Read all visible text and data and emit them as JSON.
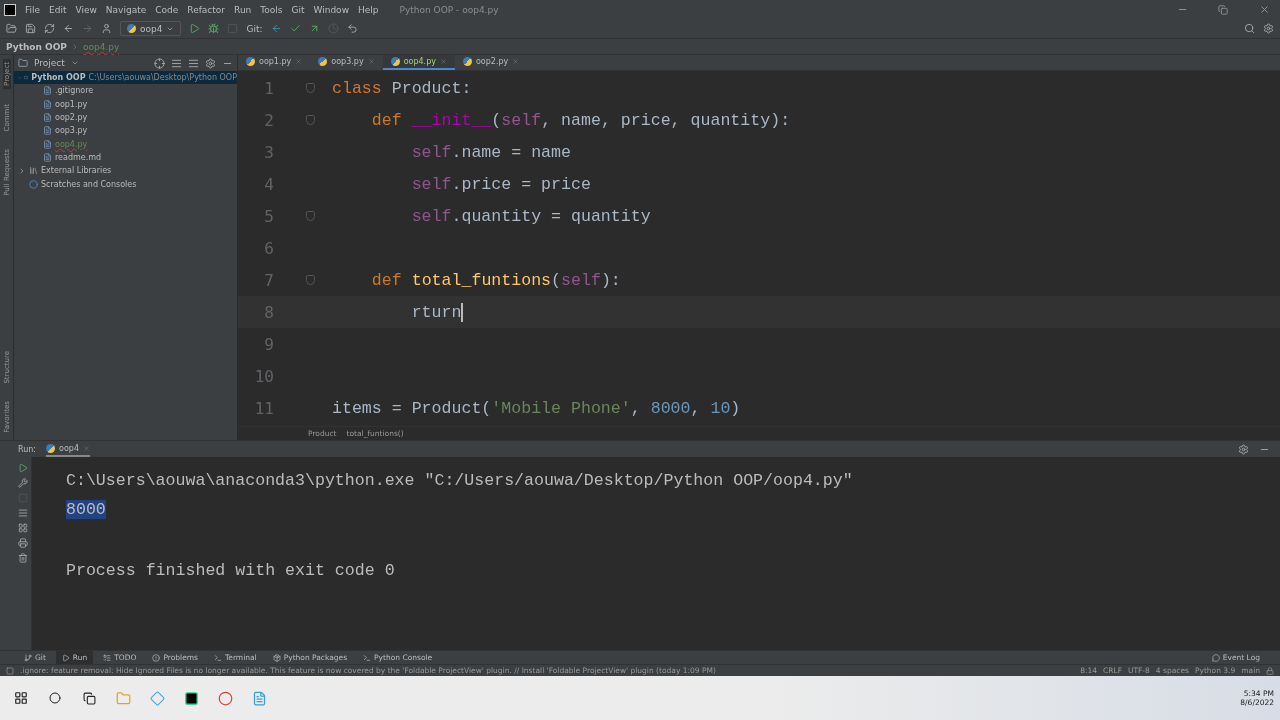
{
  "title_bar": {
    "menu": [
      "File",
      "Edit",
      "View",
      "Navigate",
      "Code",
      "Refactor",
      "Run",
      "Tools",
      "Git",
      "Window",
      "Help"
    ],
    "title": "Python OOP - oop4.py"
  },
  "toolbar": {
    "run_config": "oop4",
    "git_label": "Git:"
  },
  "breadcrumb": [
    "Python OOP",
    "oop4.py"
  ],
  "side_strip": {
    "top": [
      {
        "label": "Project",
        "selected": true
      },
      {
        "label": "Commit",
        "selected": false
      },
      {
        "label": "Pull Requests",
        "selected": false
      }
    ],
    "bottom": [
      {
        "label": "Structure",
        "selected": false
      },
      {
        "label": "Favorites",
        "selected": false
      }
    ]
  },
  "project_panel": {
    "title": "Project",
    "tree": [
      {
        "label": "Python OOP",
        "path": "C:\\Users\\aouwa\\Desktop\\Python OOP",
        "expanded": true,
        "selected": true,
        "kind": "folder",
        "children": [
          {
            "label": ".gitignore",
            "kind": "file",
            "modified": false
          },
          {
            "label": "oop1.py",
            "kind": "file",
            "modified": false
          },
          {
            "label": "oop2.py",
            "kind": "file",
            "modified": false
          },
          {
            "label": "oop3.py",
            "kind": "file",
            "modified": false
          },
          {
            "label": "oop4.py",
            "kind": "file",
            "modified": true
          },
          {
            "label": "readme.md",
            "kind": "file",
            "modified": false
          }
        ]
      },
      {
        "label": "External Libraries",
        "expanded": false,
        "selected": false,
        "kind": "library"
      },
      {
        "label": "Scratches and Consoles",
        "selected": false,
        "kind": "scratch"
      }
    ]
  },
  "editor_tabs": [
    {
      "label": "oop1.py",
      "selected": false
    },
    {
      "label": "oop3.py",
      "selected": false
    },
    {
      "label": "oop4.py",
      "selected": true
    },
    {
      "label": "oop2.py",
      "selected": false
    }
  ],
  "code_lines": [
    {
      "number": "1",
      "tokens": [
        {
          "kind": "keyword",
          "text": "class "
        },
        {
          "kind": "plain",
          "text": "Product:"
        }
      ]
    },
    {
      "number": "2",
      "tokens": [
        {
          "kind": "keyword",
          "text": "    def "
        },
        {
          "kind": "magic",
          "text": "__init__"
        },
        {
          "kind": "plain",
          "text": "("
        },
        {
          "kind": "self",
          "text": "self"
        },
        {
          "kind": "plain",
          "text": ", name, price, quantity):"
        }
      ]
    },
    {
      "number": "3",
      "tokens": [
        {
          "kind": "self",
          "text": "        self"
        },
        {
          "kind": "plain",
          "text": ".name = name"
        }
      ]
    },
    {
      "number": "4",
      "tokens": [
        {
          "kind": "self",
          "text": "        self"
        },
        {
          "kind": "plain",
          "text": ".price = price"
        }
      ]
    },
    {
      "number": "5",
      "tokens": [
        {
          "kind": "self",
          "text": "        self"
        },
        {
          "kind": "plain",
          "text": ".quantity = quantity"
        }
      ]
    },
    {
      "number": "6"
    },
    {
      "number": "7",
      "tokens": [
        {
          "kind": "keyword",
          "text": "    def "
        },
        {
          "kind": "function",
          "text": "total_funtions"
        },
        {
          "kind": "plain",
          "text": "("
        },
        {
          "kind": "self",
          "text": "self"
        },
        {
          "kind": "plain",
          "text": "):"
        }
      ]
    },
    {
      "number": "8",
      "current": true,
      "tokens": [
        {
          "kind": "plain",
          "text": "        rturn"
        }
      ]
    },
    {
      "number": "9"
    },
    {
      "number": "10"
    },
    {
      "number": "11",
      "tokens": [
        {
          "kind": "plain",
          "text": "items = Product("
        },
        {
          "kind": "string",
          "text": "'Mobile Phone'"
        },
        {
          "kind": "plain",
          "text": ", "
        },
        {
          "kind": "number",
          "text": "8000"
        },
        {
          "kind": "plain",
          "text": ", "
        },
        {
          "kind": "number",
          "text": "10"
        },
        {
          "kind": "plain",
          "text": ")"
        }
      ]
    }
  ],
  "code_breadcrumb": [
    "Product",
    "total_funtions()"
  ],
  "run_panel": {
    "label": "Run:",
    "tab": "oop4",
    "console": [
      {
        "kind": "command",
        "text": "C:\\Users\\aouwa\\anaconda3\\python.exe \"C:/Users/aouwa/Desktop/Python OOP/oop4.py\"",
        "selected": false
      },
      {
        "kind": "output",
        "text": "8000",
        "selected": true
      },
      {
        "kind": "info",
        "text": "Process finished with exit code 0",
        "selected": false
      }
    ]
  },
  "bottom_tools": [
    {
      "label": "Git",
      "selected": false
    },
    {
      "label": "Run",
      "selected": true
    },
    {
      "label": "TODO",
      "selected": false
    },
    {
      "label": "Problems",
      "selected": false
    },
    {
      "label": "Terminal",
      "selected": false
    },
    {
      "label": "Python Packages",
      "selected": false
    },
    {
      "label": "Python Console",
      "selected": false
    }
  ],
  "event_log": "Event Log",
  "status_bar": {
    "message": ".ignore: feature removal: Hide Ignored Files is no longer available. This feature is now covered by the 'Foldable ProjectView' plugin. // Install 'Foldable ProjectView' plugin (today 1:09 PM)",
    "items": [
      "8:14",
      "CRLF",
      "UTF-8",
      "4 spaces",
      "Python 3.9",
      "main"
    ]
  },
  "taskbar": {
    "time": "5:34 PM",
    "date": "8/6/2022"
  }
}
